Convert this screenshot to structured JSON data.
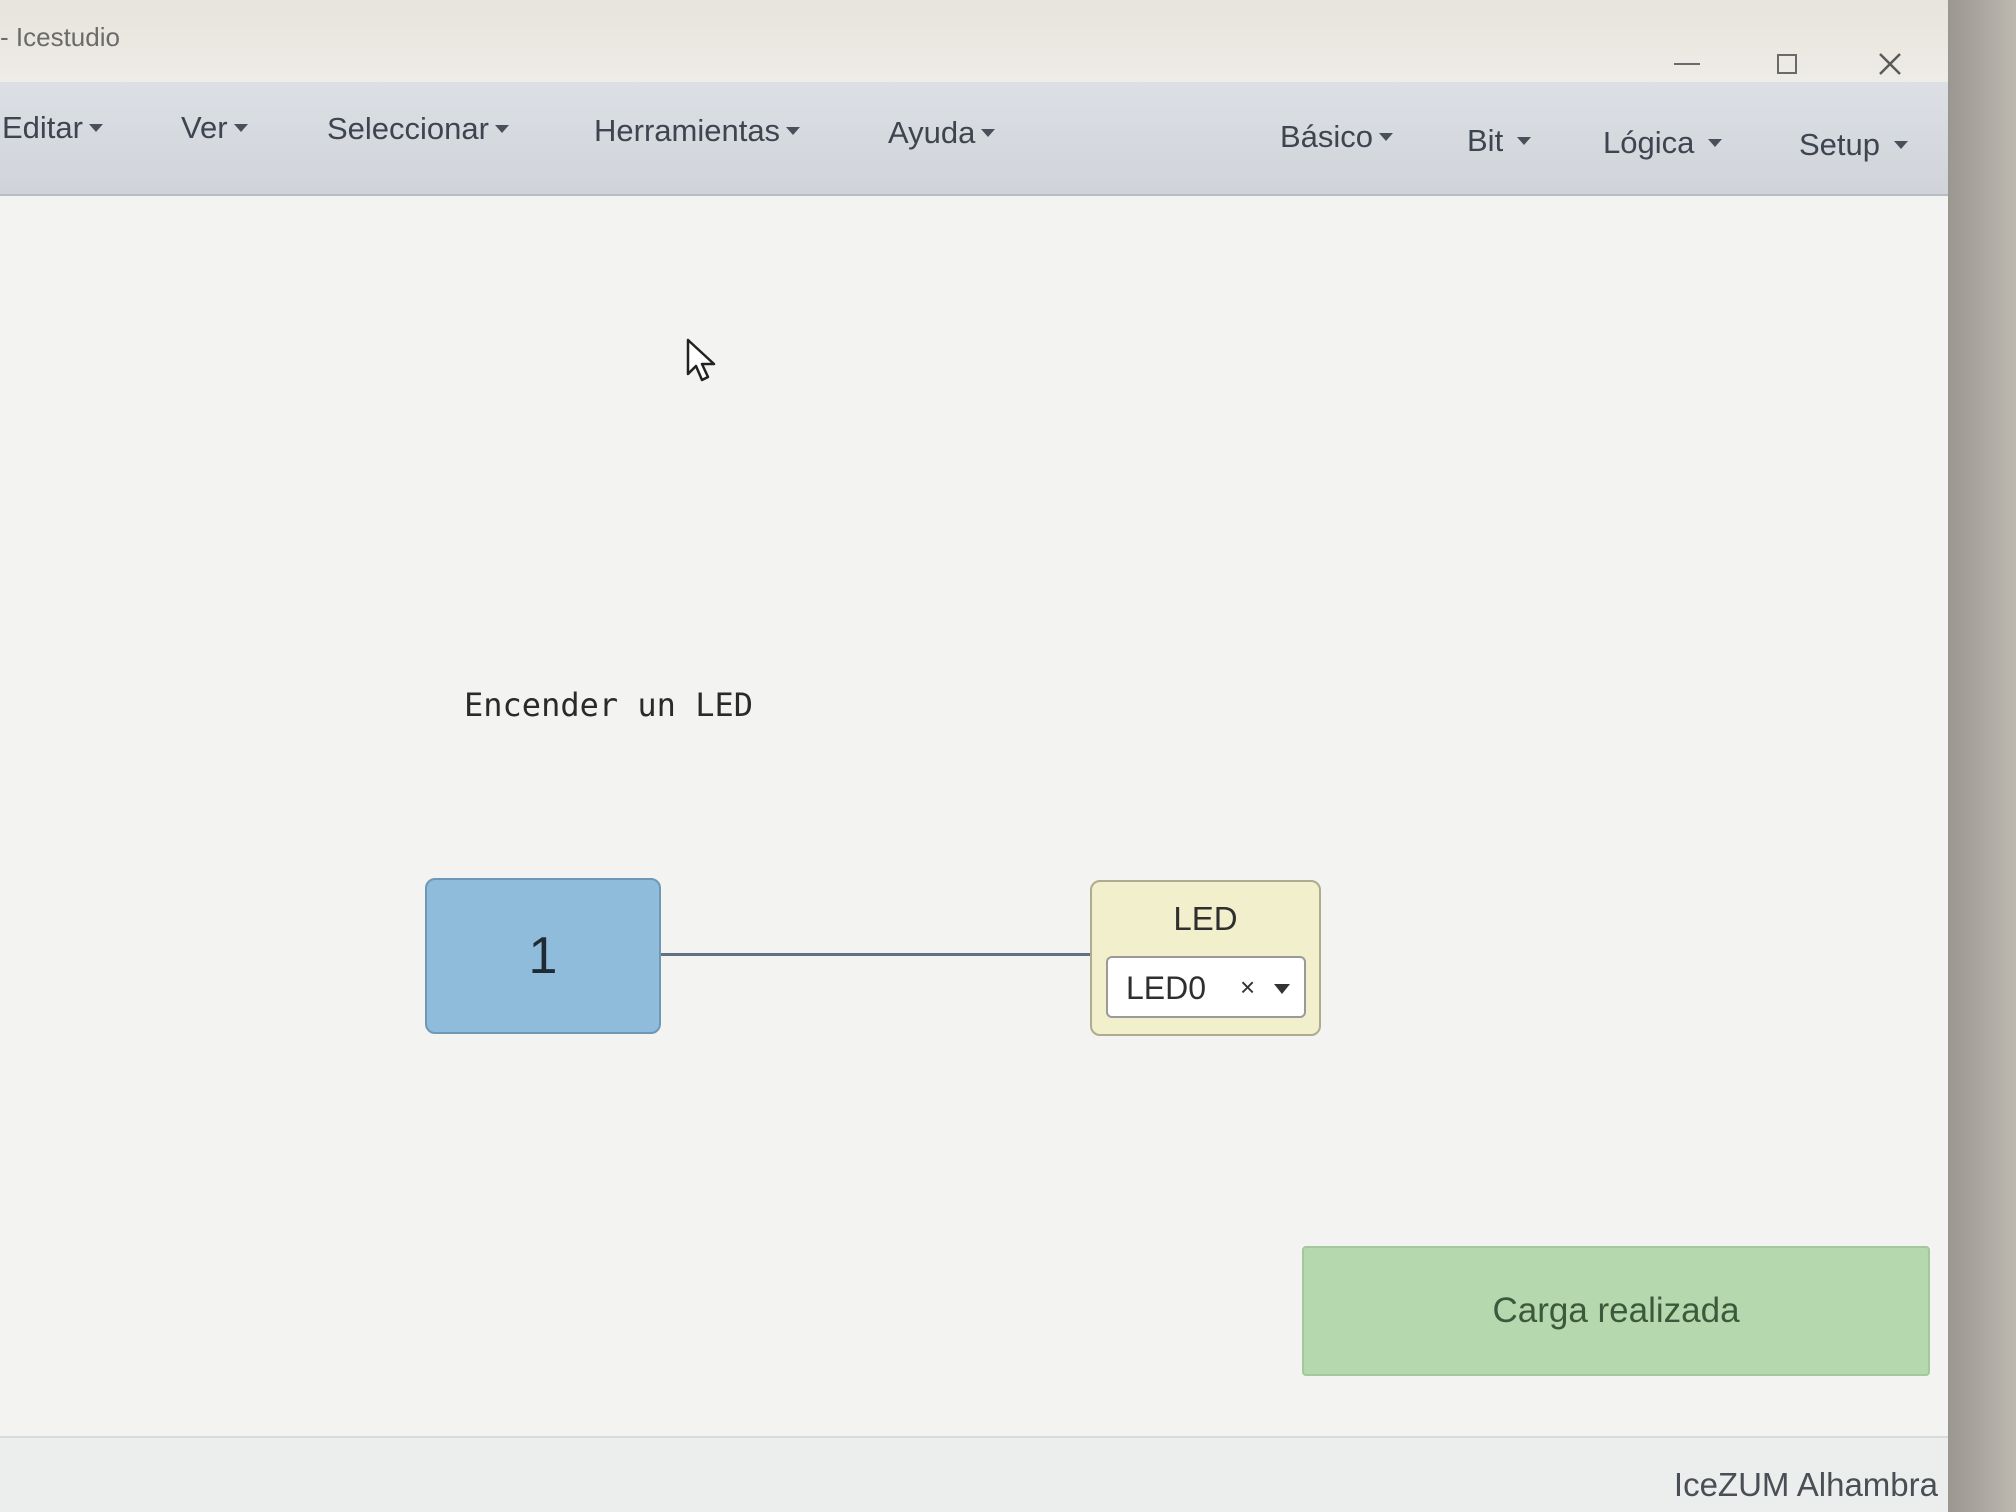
{
  "window": {
    "title": "- Icestudio"
  },
  "menubar": {
    "left_items": [
      {
        "label": "Editar"
      },
      {
        "label": "Ver"
      },
      {
        "label": "Seleccionar"
      },
      {
        "label": "Herramientas"
      },
      {
        "label": "Ayuda"
      }
    ],
    "right_items": [
      {
        "label": "Básico"
      },
      {
        "label": "Bit"
      },
      {
        "label": "Lógica"
      },
      {
        "label": "Setup"
      }
    ]
  },
  "canvas": {
    "comment": "Encender un LED",
    "constant_block": {
      "value": "1"
    },
    "led_block": {
      "title": "LED",
      "selected_pin": "LED0",
      "clear_symbol": "×"
    }
  },
  "notification": {
    "message": "Carga realizada"
  },
  "footer": {
    "board": "IceZUM Alhambra"
  },
  "colors": {
    "constant_block": "#90bcdc",
    "led_block": "#f2efcc",
    "notification_bg": "#b6d8ae",
    "wire": "#5f7285"
  },
  "icons": [
    "cursor-arrow-icon",
    "minimize-icon",
    "maximize-icon",
    "close-icon",
    "caret-down-icon"
  ]
}
